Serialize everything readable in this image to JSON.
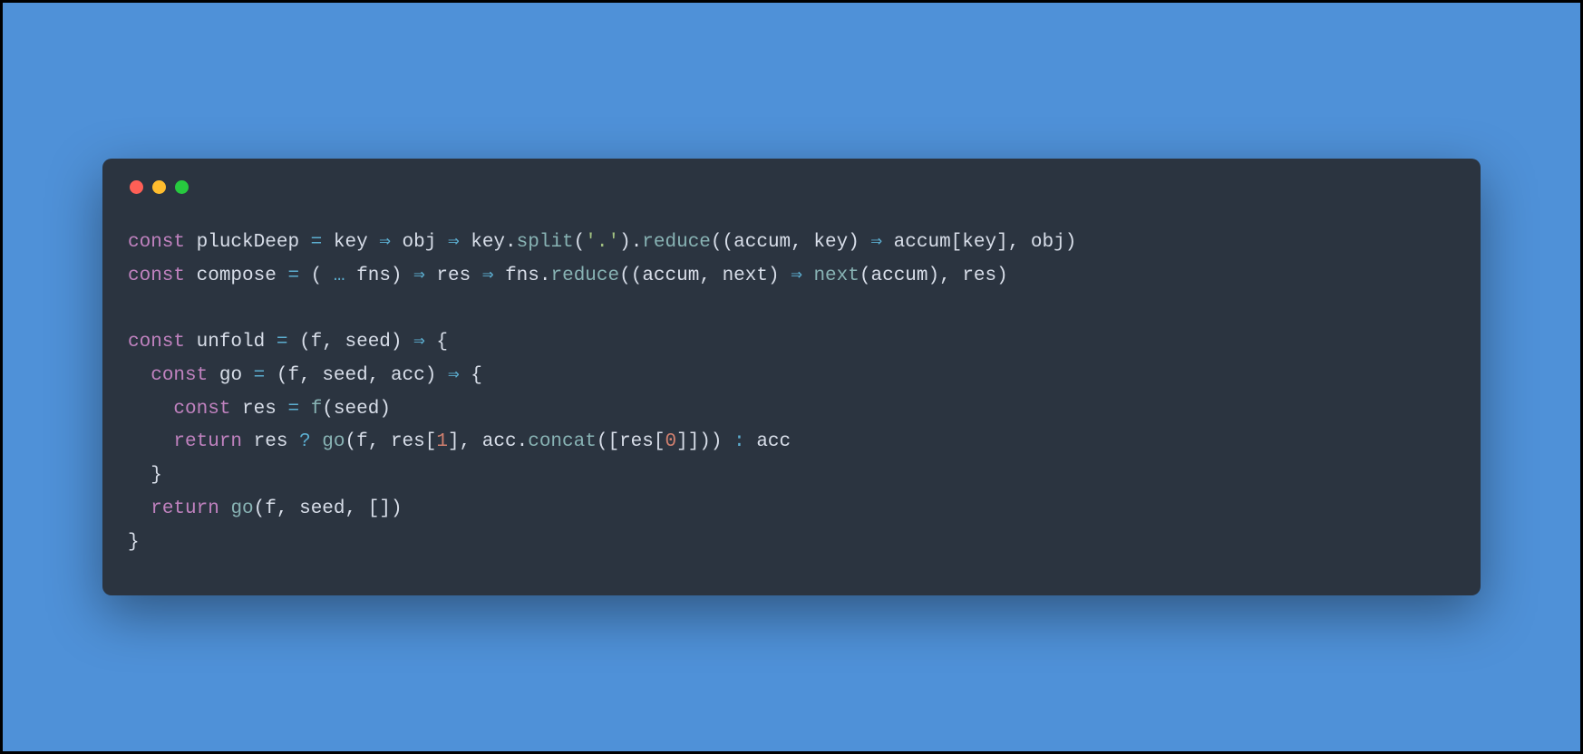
{
  "window": {
    "controls": [
      "red",
      "yellow",
      "green"
    ]
  },
  "code": {
    "tokens": [
      [
        {
          "t": "const ",
          "c": "kw"
        },
        {
          "t": "pluckDeep ",
          "c": "def"
        },
        {
          "t": "= ",
          "c": "op"
        },
        {
          "t": "key ",
          "c": "def"
        },
        {
          "t": "⇒ ",
          "c": "op"
        },
        {
          "t": "obj ",
          "c": "def"
        },
        {
          "t": "⇒ ",
          "c": "op"
        },
        {
          "t": "key",
          "c": "def"
        },
        {
          "t": ".",
          "c": "punc"
        },
        {
          "t": "split",
          "c": "call"
        },
        {
          "t": "(",
          "c": "punc"
        },
        {
          "t": "'.'",
          "c": "str"
        },
        {
          "t": ")",
          "c": "punc"
        },
        {
          "t": ".",
          "c": "punc"
        },
        {
          "t": "reduce",
          "c": "call"
        },
        {
          "t": "((",
          "c": "punc"
        },
        {
          "t": "accum",
          "c": "def"
        },
        {
          "t": ", ",
          "c": "punc"
        },
        {
          "t": "key",
          "c": "def"
        },
        {
          "t": ") ",
          "c": "punc"
        },
        {
          "t": "⇒ ",
          "c": "op"
        },
        {
          "t": "accum",
          "c": "def"
        },
        {
          "t": "[",
          "c": "punc"
        },
        {
          "t": "key",
          "c": "def"
        },
        {
          "t": "]",
          "c": "punc"
        },
        {
          "t": ", ",
          "c": "punc"
        },
        {
          "t": "obj",
          "c": "def"
        },
        {
          "t": ")",
          "c": "punc"
        }
      ],
      [
        {
          "t": "const ",
          "c": "kw"
        },
        {
          "t": "compose ",
          "c": "def"
        },
        {
          "t": "= ",
          "c": "op"
        },
        {
          "t": "( ",
          "c": "punc"
        },
        {
          "t": "… ",
          "c": "op"
        },
        {
          "t": "fns",
          "c": "def"
        },
        {
          "t": ") ",
          "c": "punc"
        },
        {
          "t": "⇒ ",
          "c": "op"
        },
        {
          "t": "res ",
          "c": "def"
        },
        {
          "t": "⇒ ",
          "c": "op"
        },
        {
          "t": "fns",
          "c": "def"
        },
        {
          "t": ".",
          "c": "punc"
        },
        {
          "t": "reduce",
          "c": "call"
        },
        {
          "t": "((",
          "c": "punc"
        },
        {
          "t": "accum",
          "c": "def"
        },
        {
          "t": ", ",
          "c": "punc"
        },
        {
          "t": "next",
          "c": "def"
        },
        {
          "t": ") ",
          "c": "punc"
        },
        {
          "t": "⇒ ",
          "c": "op"
        },
        {
          "t": "next",
          "c": "call"
        },
        {
          "t": "(",
          "c": "punc"
        },
        {
          "t": "accum",
          "c": "def"
        },
        {
          "t": ")",
          "c": "punc"
        },
        {
          "t": ", ",
          "c": "punc"
        },
        {
          "t": "res",
          "c": "def"
        },
        {
          "t": ")",
          "c": "punc"
        }
      ],
      [],
      [
        {
          "t": "const ",
          "c": "kw"
        },
        {
          "t": "unfold ",
          "c": "def"
        },
        {
          "t": "= ",
          "c": "op"
        },
        {
          "t": "(",
          "c": "punc"
        },
        {
          "t": "f",
          "c": "def"
        },
        {
          "t": ", ",
          "c": "punc"
        },
        {
          "t": "seed",
          "c": "def"
        },
        {
          "t": ") ",
          "c": "punc"
        },
        {
          "t": "⇒ ",
          "c": "op"
        },
        {
          "t": "{",
          "c": "punc"
        }
      ],
      [
        {
          "t": "  ",
          "c": "punc"
        },
        {
          "t": "const ",
          "c": "kw"
        },
        {
          "t": "go ",
          "c": "def"
        },
        {
          "t": "= ",
          "c": "op"
        },
        {
          "t": "(",
          "c": "punc"
        },
        {
          "t": "f",
          "c": "def"
        },
        {
          "t": ", ",
          "c": "punc"
        },
        {
          "t": "seed",
          "c": "def"
        },
        {
          "t": ", ",
          "c": "punc"
        },
        {
          "t": "acc",
          "c": "def"
        },
        {
          "t": ") ",
          "c": "punc"
        },
        {
          "t": "⇒ ",
          "c": "op"
        },
        {
          "t": "{",
          "c": "punc"
        }
      ],
      [
        {
          "t": "    ",
          "c": "punc"
        },
        {
          "t": "const ",
          "c": "kw"
        },
        {
          "t": "res ",
          "c": "def"
        },
        {
          "t": "= ",
          "c": "op"
        },
        {
          "t": "f",
          "c": "call"
        },
        {
          "t": "(",
          "c": "punc"
        },
        {
          "t": "seed",
          "c": "def"
        },
        {
          "t": ")",
          "c": "punc"
        }
      ],
      [
        {
          "t": "    ",
          "c": "punc"
        },
        {
          "t": "return ",
          "c": "kw"
        },
        {
          "t": "res ",
          "c": "def"
        },
        {
          "t": "? ",
          "c": "op"
        },
        {
          "t": "go",
          "c": "call"
        },
        {
          "t": "(",
          "c": "punc"
        },
        {
          "t": "f",
          "c": "def"
        },
        {
          "t": ", ",
          "c": "punc"
        },
        {
          "t": "res",
          "c": "def"
        },
        {
          "t": "[",
          "c": "punc"
        },
        {
          "t": "1",
          "c": "num"
        },
        {
          "t": "]",
          "c": "punc"
        },
        {
          "t": ", ",
          "c": "punc"
        },
        {
          "t": "acc",
          "c": "def"
        },
        {
          "t": ".",
          "c": "punc"
        },
        {
          "t": "concat",
          "c": "call"
        },
        {
          "t": "([",
          "c": "punc"
        },
        {
          "t": "res",
          "c": "def"
        },
        {
          "t": "[",
          "c": "punc"
        },
        {
          "t": "0",
          "c": "num"
        },
        {
          "t": "]",
          "c": "punc"
        },
        {
          "t": "]))",
          "c": "punc"
        },
        {
          "t": " : ",
          "c": "op"
        },
        {
          "t": "acc",
          "c": "def"
        }
      ],
      [
        {
          "t": "  }",
          "c": "punc"
        }
      ],
      [
        {
          "t": "  ",
          "c": "punc"
        },
        {
          "t": "return ",
          "c": "kw"
        },
        {
          "t": "go",
          "c": "call"
        },
        {
          "t": "(",
          "c": "punc"
        },
        {
          "t": "f",
          "c": "def"
        },
        {
          "t": ", ",
          "c": "punc"
        },
        {
          "t": "seed",
          "c": "def"
        },
        {
          "t": ", ",
          "c": "punc"
        },
        {
          "t": "[])",
          "c": "punc"
        }
      ],
      [
        {
          "t": "}",
          "c": "punc"
        }
      ]
    ]
  },
  "colors": {
    "background_outer": "#4f91d8",
    "window_bg": "#2b3440",
    "kw": "#c082bf",
    "call": "#88b3b4",
    "op": "#5caed0",
    "str": "#a2c181",
    "num": "#d1806f",
    "text": "#d8dee9"
  }
}
